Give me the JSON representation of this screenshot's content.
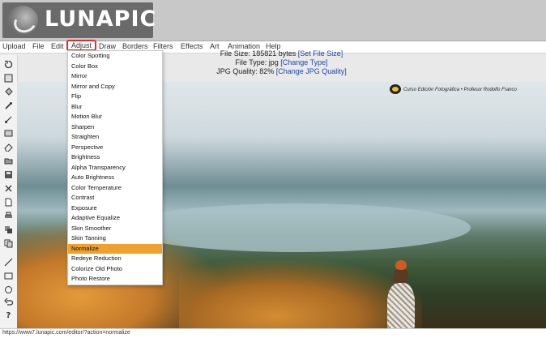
{
  "logo": {
    "text": "LUNAPIC"
  },
  "menu": [
    {
      "label": "Upload",
      "active": false
    },
    {
      "label": "File",
      "active": false
    },
    {
      "label": "Edit",
      "active": false
    },
    {
      "label": "Adjust",
      "active": true
    },
    {
      "label": "Draw",
      "active": false
    },
    {
      "label": "Borders",
      "active": false
    },
    {
      "label": "Filters",
      "active": false
    },
    {
      "label": "Effects",
      "active": false
    },
    {
      "label": "Art",
      "active": false
    },
    {
      "label": "Animation",
      "active": false
    },
    {
      "label": "Help",
      "active": false
    }
  ],
  "info": {
    "file_size_label": "File Size: 185821 bytes",
    "file_size_link": "[Set File Size]",
    "file_type_label": "File Type: jpg",
    "file_type_link": "[Change Type]",
    "jpg_quality_label": "JPG Quality: 82%",
    "jpg_quality_link": "[Change JPG Quality]"
  },
  "adjust_menu": {
    "items": [
      "Color Spotting",
      "Color Box",
      "Mirror",
      "Mirror and Copy",
      "Flip",
      "Blur",
      "Motion Blur",
      "Sharpen",
      "Straighten",
      "Perspective",
      "Brightness",
      "Alpha Transparency",
      "Auto Brightness",
      "Color Temperature",
      "Contrast",
      "Exposure",
      "Adaptive Equalize",
      "Skin Smoother",
      "Skin Tanning",
      "Normalize",
      "Redeye Reduction",
      "Colorize Old Photo",
      "Photo Restore"
    ],
    "highlighted": "Normalize"
  },
  "watermark": {
    "text": "Curso Edición Fotográfica • Profesor Rodolfo Franco"
  },
  "sidebar_tools": [
    "rotate-icon",
    "crop-icon",
    "bucket-icon",
    "eyedropper-icon",
    "brush-icon",
    "text-icon",
    "eraser-icon",
    "folder-icon",
    "save-icon",
    "close-icon",
    "new-file-icon",
    "print-icon",
    "layers-icon",
    "copy-icon",
    "paste-icon",
    "line-icon",
    "rectangle-icon",
    "circle-icon",
    "undo-icon",
    "help-icon"
  ],
  "status": {
    "url": "https://www7.lunapic.com/editor/?action=normalize"
  },
  "colors": {
    "menu_highlight": "#f0a02c",
    "active_outline": "#d9312b",
    "link": "#1e49a8"
  }
}
